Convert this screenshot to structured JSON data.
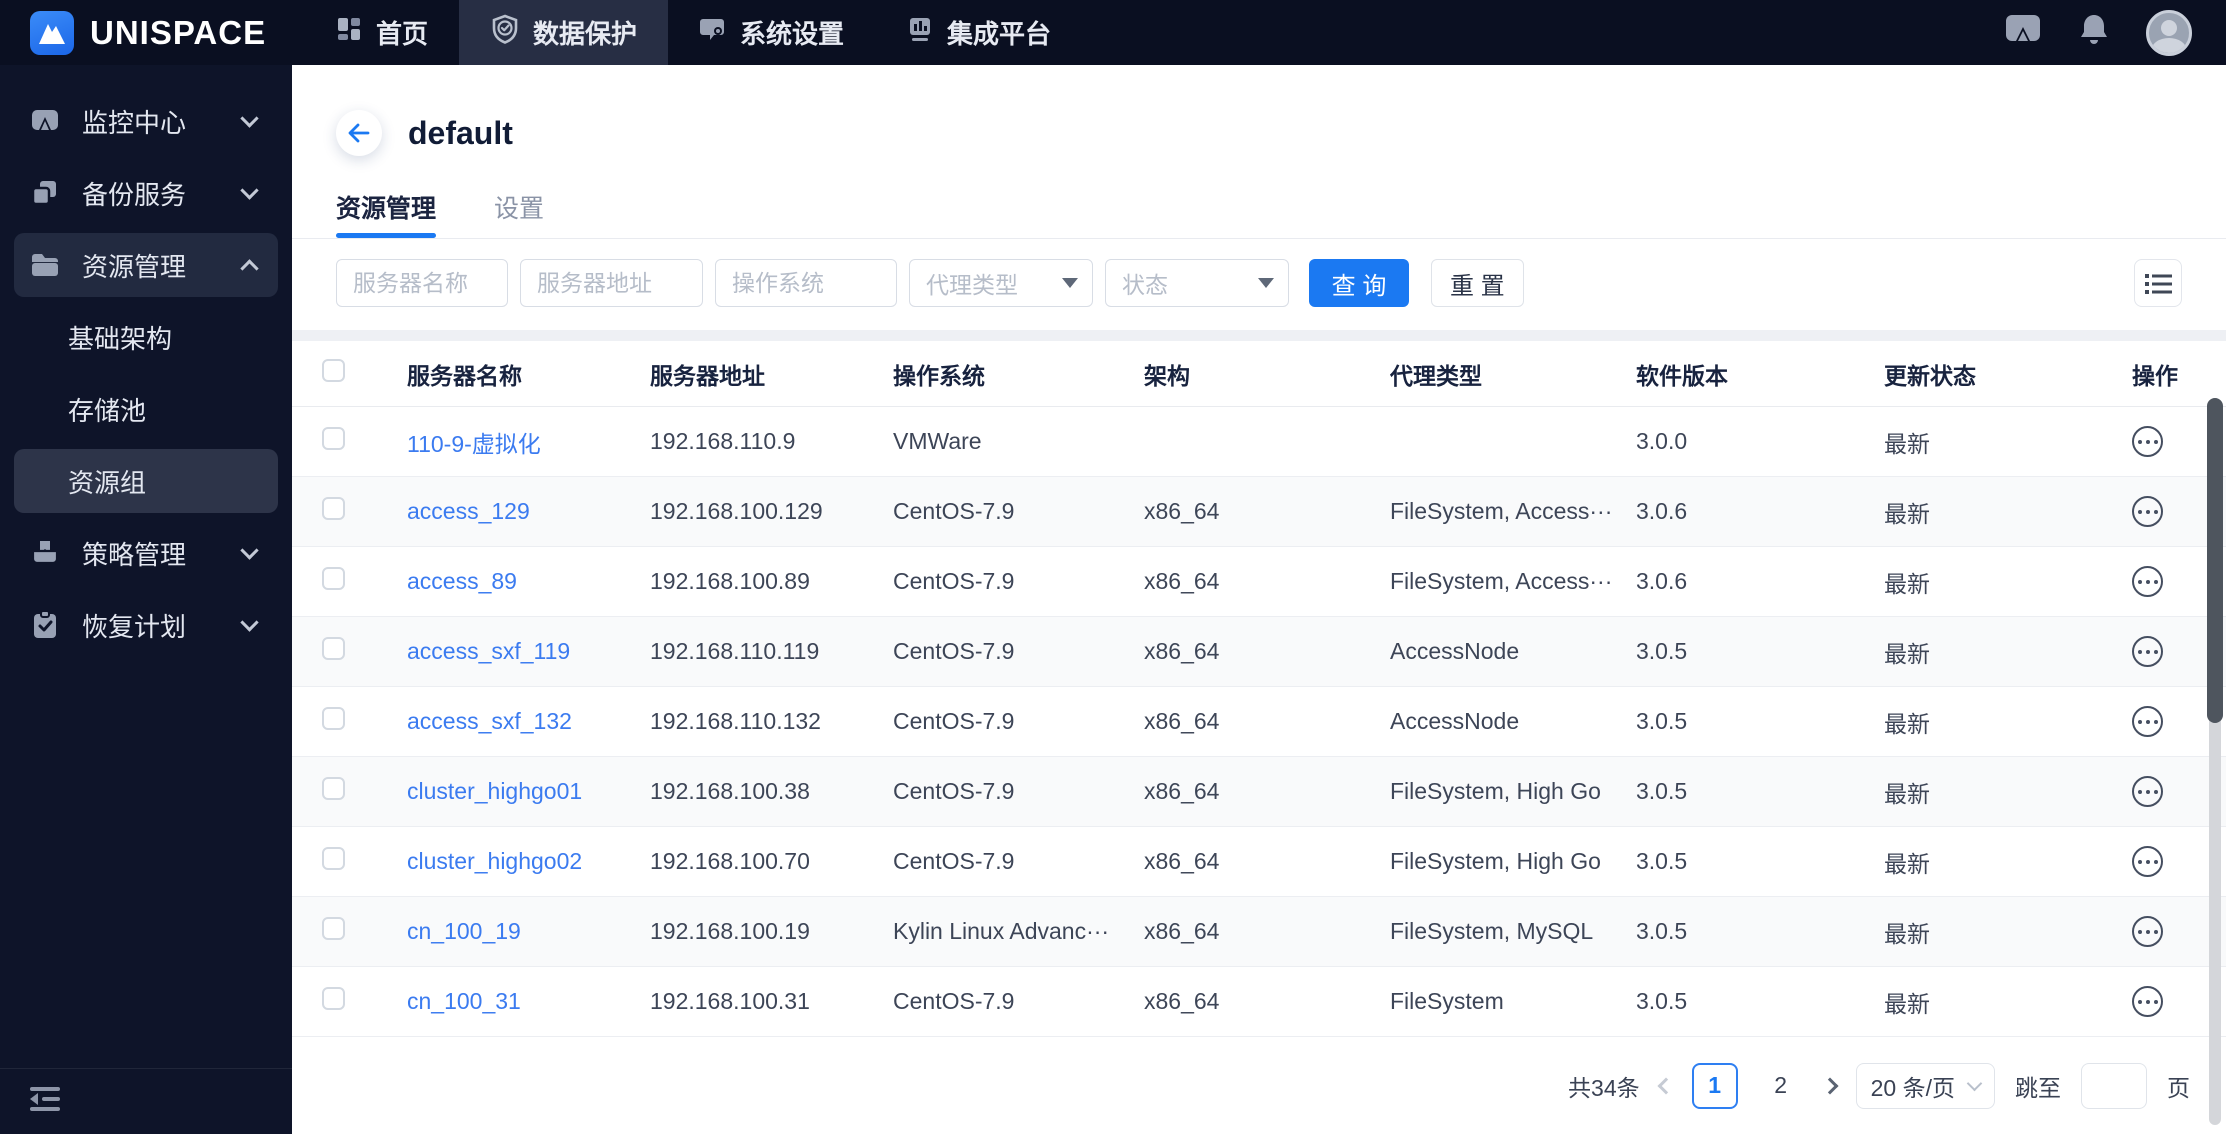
{
  "brand": {
    "name": "UNISPACE"
  },
  "topnav": {
    "items": [
      {
        "label": "首页",
        "icon": "dashboard-grid-icon",
        "active": false
      },
      {
        "label": "数据保护",
        "icon": "shield-check-icon",
        "active": true
      },
      {
        "label": "系统设置",
        "icon": "system-settings-icon",
        "active": false
      },
      {
        "label": "集成平台",
        "icon": "chart-board-icon",
        "active": false
      }
    ]
  },
  "top_right_icons": [
    "message-icon",
    "bell-icon",
    "user-avatar"
  ],
  "sidebar": {
    "items": [
      {
        "label": "监控中心",
        "type": "parent",
        "icon": "monitor-icon",
        "chevron": "down"
      },
      {
        "label": "备份服务",
        "type": "parent",
        "icon": "backup-copy-icon",
        "chevron": "down"
      },
      {
        "label": "资源管理",
        "type": "parent",
        "icon": "folder-icon",
        "chevron": "up",
        "expanded": true
      },
      {
        "label": "基础架构",
        "type": "sub",
        "active": false
      },
      {
        "label": "存储池",
        "type": "sub",
        "active": false
      },
      {
        "label": "资源组",
        "type": "sub",
        "active": true
      },
      {
        "label": "策略管理",
        "type": "parent",
        "icon": "policy-book-icon",
        "chevron": "down"
      },
      {
        "label": "恢复计划",
        "type": "parent",
        "icon": "clipboard-check-icon",
        "chevron": "down"
      }
    ]
  },
  "page": {
    "title": "default",
    "tabs": [
      {
        "label": "资源管理",
        "active": true
      },
      {
        "label": "设置",
        "active": false
      }
    ]
  },
  "filters": {
    "inputs": [
      {
        "placeholder": "服务器名称"
      },
      {
        "placeholder": "服务器地址"
      },
      {
        "placeholder": "操作系统"
      }
    ],
    "selects": [
      {
        "placeholder": "代理类型"
      },
      {
        "placeholder": "状态"
      }
    ],
    "search_label": "查 询",
    "reset_label": "重 置"
  },
  "table": {
    "columns": [
      "服务器名称",
      "服务器地址",
      "操作系统",
      "架构",
      "代理类型",
      "软件版本",
      "更新状态",
      "操作"
    ],
    "rows": [
      {
        "name": "110-9-虚拟化",
        "address": "192.168.110.9",
        "os": "VMWare",
        "arch": "",
        "agent": "",
        "version": "3.0.0",
        "status": "最新"
      },
      {
        "name": "access_129",
        "address": "192.168.100.129",
        "os": "CentOS-7.9",
        "arch": "x86_64",
        "agent": "FileSystem, Access···",
        "version": "3.0.6",
        "status": "最新"
      },
      {
        "name": "access_89",
        "address": "192.168.100.89",
        "os": "CentOS-7.9",
        "arch": "x86_64",
        "agent": "FileSystem, Access···",
        "version": "3.0.6",
        "status": "最新"
      },
      {
        "name": "access_sxf_119",
        "address": "192.168.110.119",
        "os": "CentOS-7.9",
        "arch": "x86_64",
        "agent": "AccessNode",
        "version": "3.0.5",
        "status": "最新"
      },
      {
        "name": "access_sxf_132",
        "address": "192.168.110.132",
        "os": "CentOS-7.9",
        "arch": "x86_64",
        "agent": "AccessNode",
        "version": "3.0.5",
        "status": "最新"
      },
      {
        "name": "cluster_highgo01",
        "address": "192.168.100.38",
        "os": "CentOS-7.9",
        "arch": "x86_64",
        "agent": "FileSystem, High Go",
        "version": "3.0.5",
        "status": "最新"
      },
      {
        "name": "cluster_highgo02",
        "address": "192.168.100.70",
        "os": "CentOS-7.9",
        "arch": "x86_64",
        "agent": "FileSystem, High Go",
        "version": "3.0.5",
        "status": "最新"
      },
      {
        "name": "cn_100_19",
        "address": "192.168.100.19",
        "os": "Kylin Linux Advanc···",
        "arch": "x86_64",
        "agent": "FileSystem, MySQL",
        "version": "3.0.5",
        "status": "最新"
      },
      {
        "name": "cn_100_31",
        "address": "192.168.100.31",
        "os": "CentOS-7.9",
        "arch": "x86_64",
        "agent": "FileSystem",
        "version": "3.0.5",
        "status": "最新"
      }
    ]
  },
  "pagination": {
    "total": "共34条",
    "pages": [
      "1",
      "2"
    ],
    "current": "1",
    "page_size": "20 条/页",
    "jump_label": "跳至",
    "jump_suffix": "页"
  },
  "icons": {
    "back": "arrow-left",
    "column_settings": "list-lines",
    "row_action": "ellipsis-in-circle",
    "sidebar_collapse": "menu-fold"
  },
  "colors": {
    "accent": "#1b79f2",
    "link": "#3b7bf0",
    "topbar_bg": "#0a0f21",
    "sidebar_bg": "#0e1429",
    "nav_active_bg": "#272e44"
  }
}
